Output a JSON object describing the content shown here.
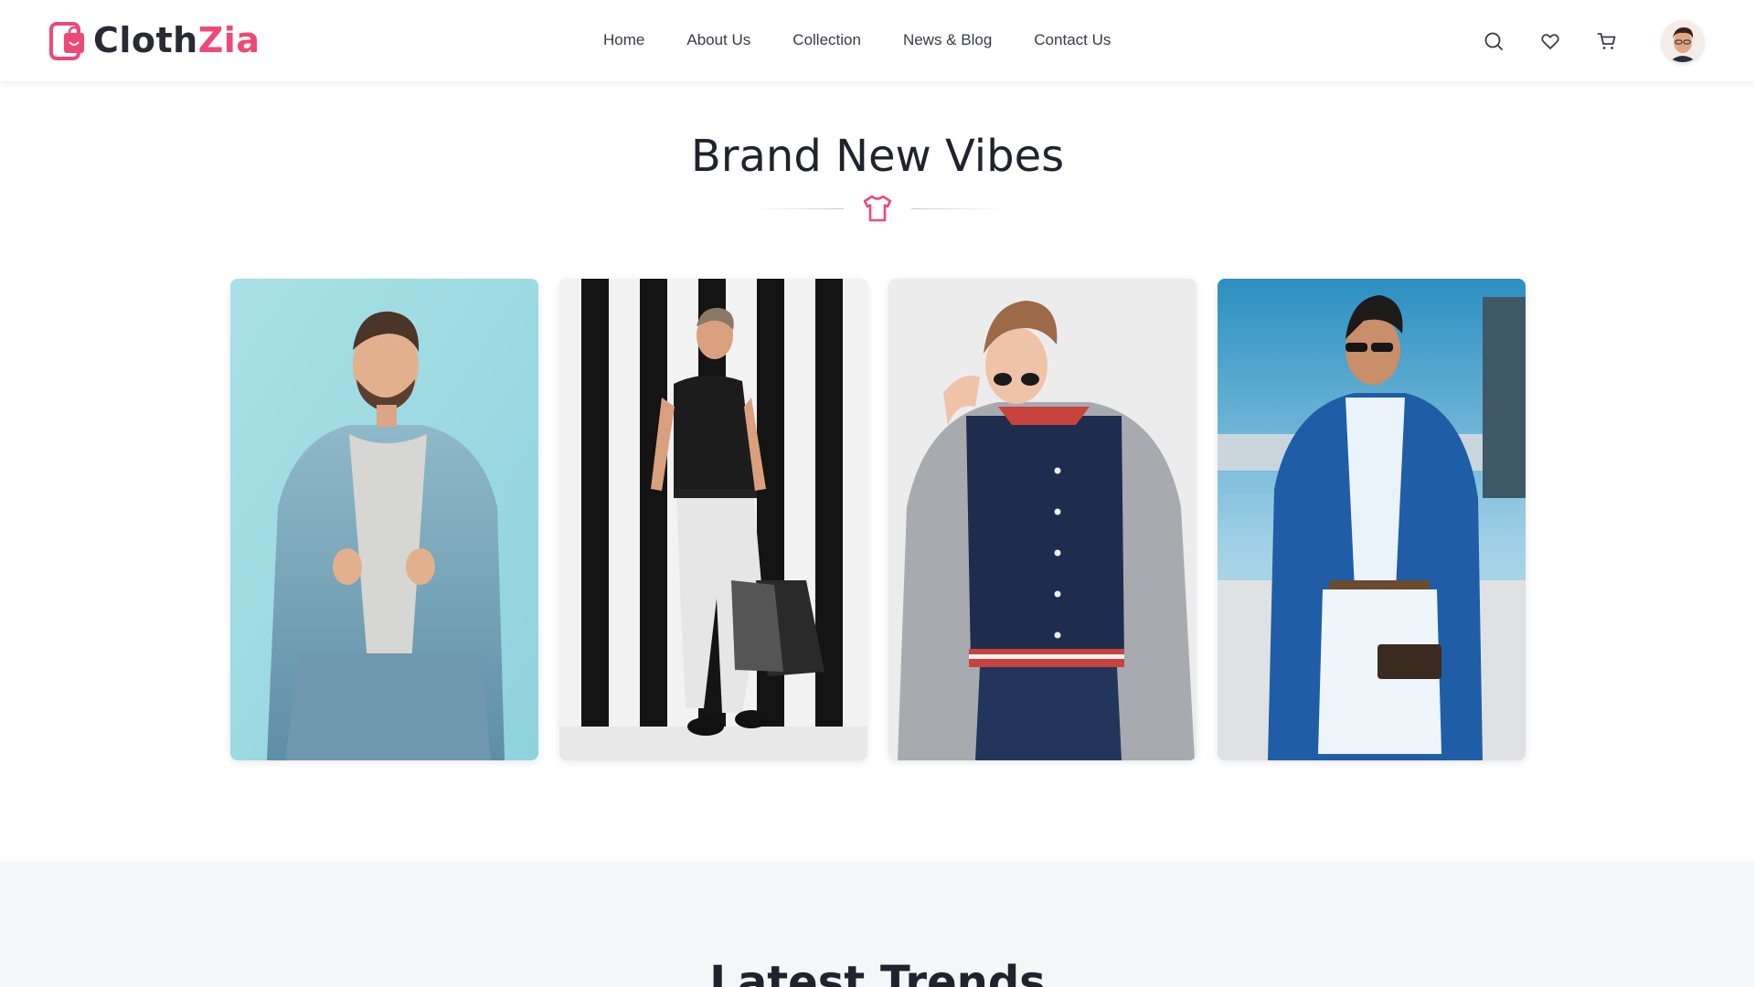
{
  "brand": {
    "name_main": "Cloth",
    "name_accent": "Zia",
    "accent_color": "#ef4878"
  },
  "nav": {
    "links": [
      {
        "label": "Home"
      },
      {
        "label": "About Us"
      },
      {
        "label": "Collection"
      },
      {
        "label": "News & Blog"
      },
      {
        "label": "Contact Us"
      }
    ],
    "icons": [
      "search-icon",
      "heart-icon",
      "cart-icon",
      "user-avatar"
    ]
  },
  "brand_section": {
    "title": "Brand New Vibes",
    "divider_icon": "tshirt-icon",
    "cards": [
      {
        "image": "denim-jacket-man"
      },
      {
        "image": "black-tee-stripes-man"
      },
      {
        "image": "varsity-jacket-man"
      },
      {
        "image": "blue-blazer-man"
      }
    ]
  },
  "trends_section": {
    "title": "Latest Trends"
  }
}
